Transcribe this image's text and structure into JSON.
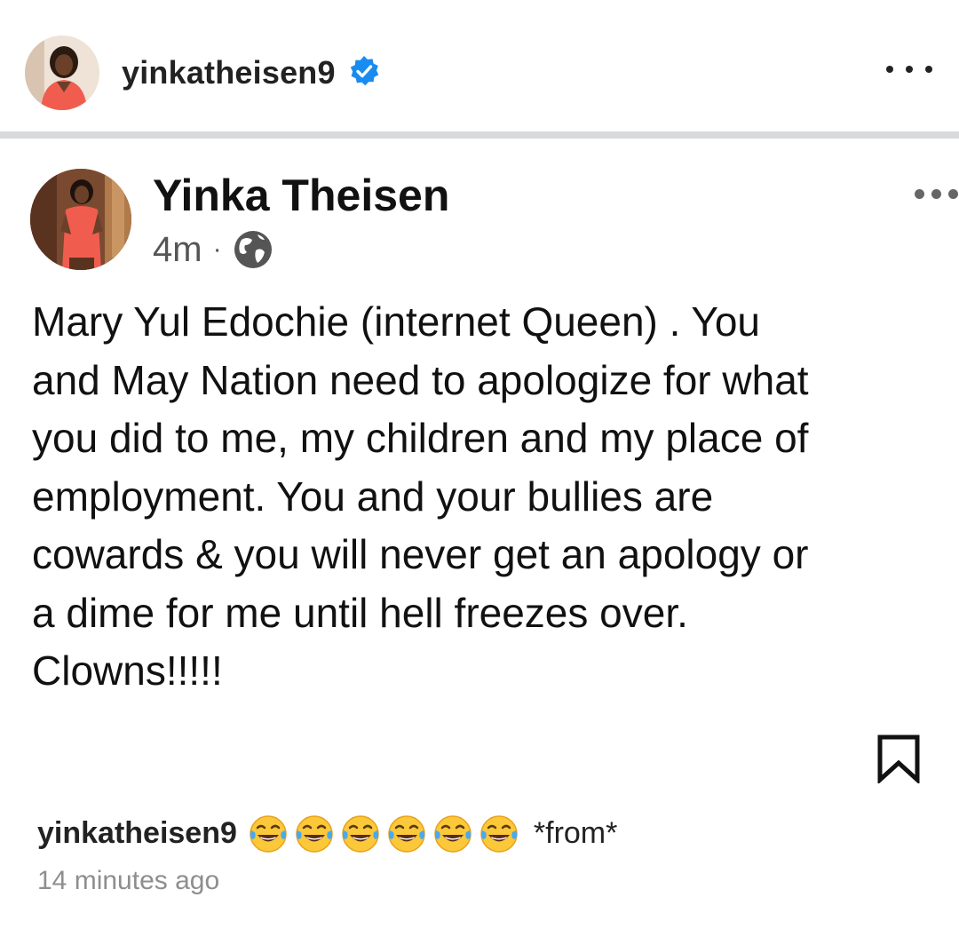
{
  "header": {
    "username": "yinkatheisen9"
  },
  "post": {
    "author_name": "Yinka Theisen",
    "time": "4m",
    "separator": "·",
    "text_lines": [
      "Mary Yul Edochie (internet Queen) . You",
      "and May Nation need to apologize for what",
      "you did to me, my children and my place of",
      "employment. You and your bullies are",
      "cowards & you will never get an apology or",
      "a dime for me until hell freezes over.",
      "Clowns!!!!!"
    ]
  },
  "caption": {
    "username": "yinkatheisen9",
    "text": "*from*",
    "emoji_count": 6,
    "time_ago": "14 minutes ago"
  },
  "colors": {
    "verified": "#1a8cf0",
    "divider": "#d9dadc",
    "dress": "#f05d4f",
    "muted": "#8e8e8e"
  }
}
